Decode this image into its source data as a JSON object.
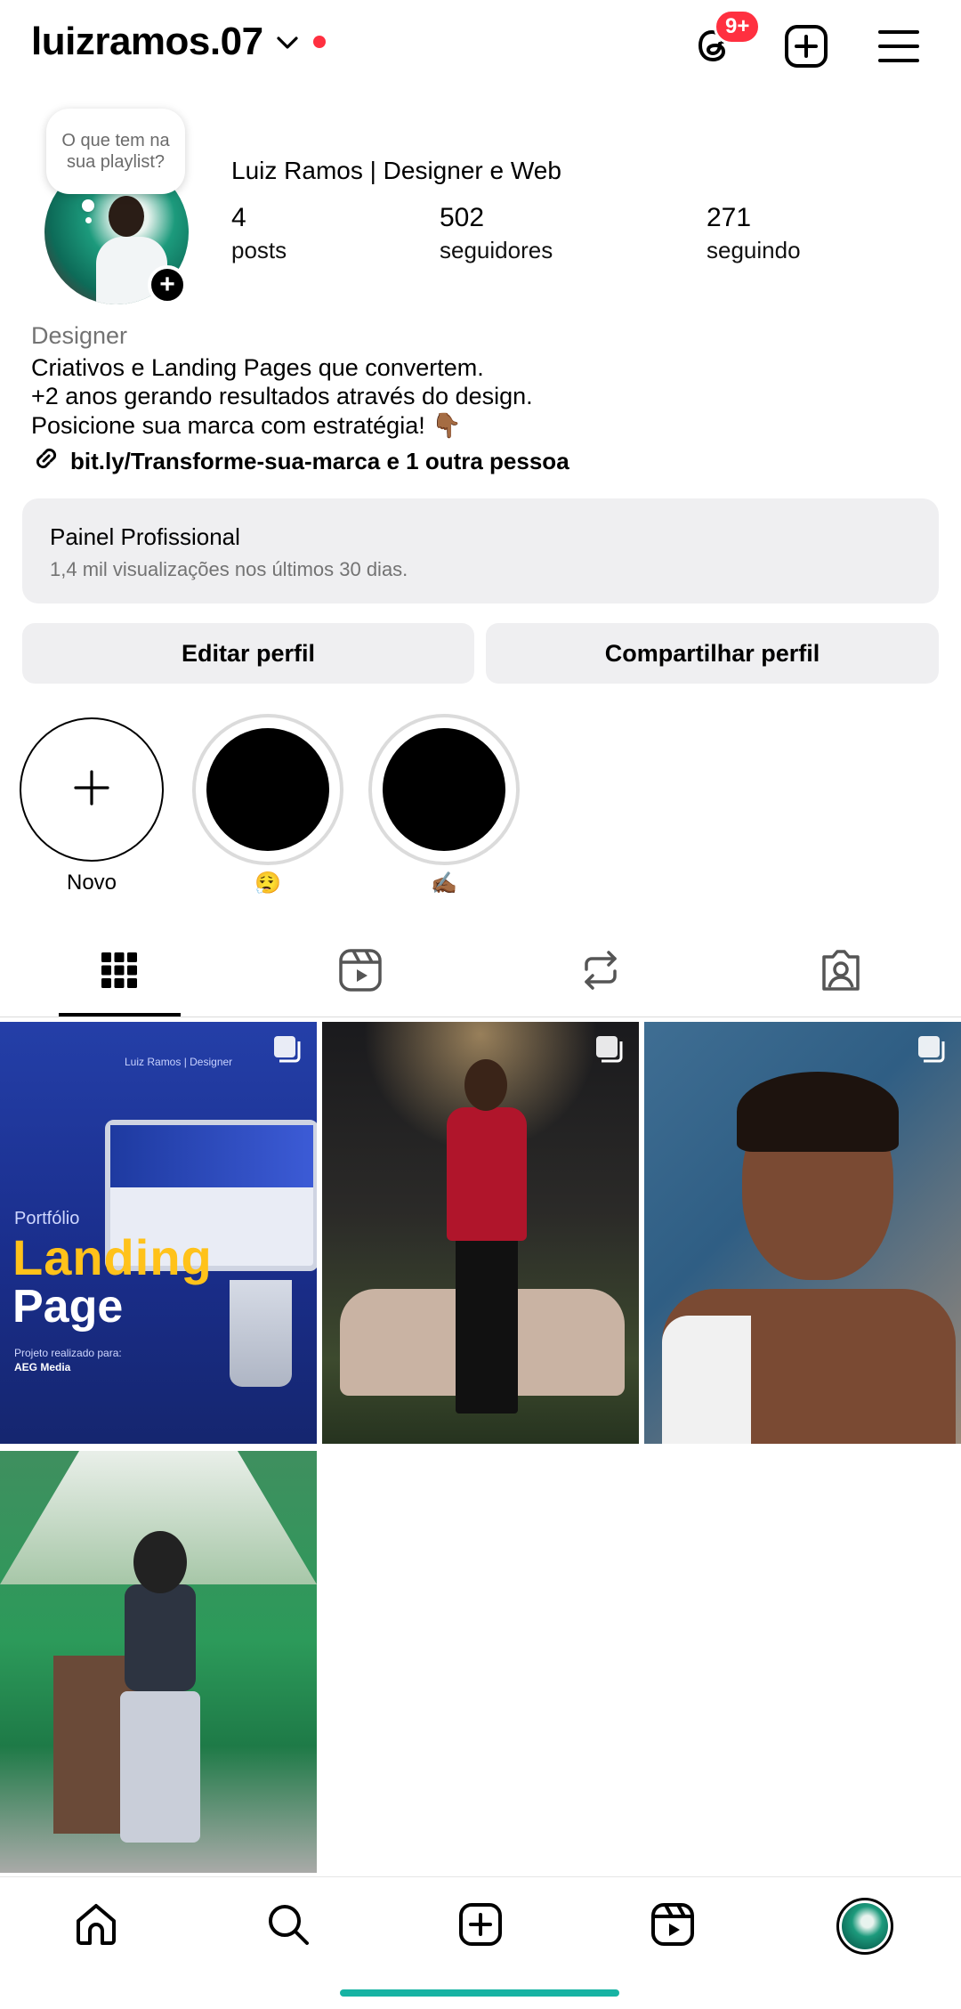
{
  "header": {
    "username": "luizramos.07",
    "notification_badge": "9+",
    "icons": {
      "threads": "threads-icon",
      "create": "plus-square-icon",
      "menu": "hamburger-menu-icon",
      "dropdown": "chevron-down-icon"
    }
  },
  "profile": {
    "note": "O que tem na sua playlist?",
    "display_name": "Luiz Ramos | Designer e Web",
    "stats": [
      {
        "value": "4",
        "label": "posts"
      },
      {
        "value": "502",
        "label": "seguidores"
      },
      {
        "value": "271",
        "label": "seguindo"
      }
    ]
  },
  "bio": {
    "category": "Designer",
    "lines": [
      "Criativos e Landing Pages que convertem.",
      "+2 anos gerando resultados através do design.",
      "Posicione sua marca com estratégia! 👇🏾"
    ],
    "link": "bit.ly/Transforme-sua-marca e 1 outra pessoa"
  },
  "dashboard": {
    "title": "Painel Profissional",
    "subtitle": "1,4 mil visualizações nos últimos 30 dias."
  },
  "actions": {
    "edit": "Editar perfil",
    "share": "Compartilhar perfil"
  },
  "highlights": [
    {
      "label": "Novo"
    },
    {
      "label": "😮‍💨"
    },
    {
      "label": "✍🏾"
    }
  ],
  "tabs": [
    "grid-icon",
    "reels-icon",
    "reposts-icon",
    "tagged-icon"
  ],
  "posts": {
    "post1": {
      "portfolio": "Portfólio",
      "landing": "Landing",
      "page": "Page",
      "header_text": "Luiz Ramos | Designer",
      "project_label": "Projeto realizado para:",
      "project_client": "AEG Media"
    }
  },
  "bottom_nav": [
    "home-icon",
    "search-icon",
    "create-icon",
    "reels-icon",
    "profile-avatar"
  ],
  "colors": {
    "accent_red": "#ff3040",
    "button_gray": "#efeff1",
    "muted_text": "#737373",
    "home_indicator": "#17b3a3"
  }
}
